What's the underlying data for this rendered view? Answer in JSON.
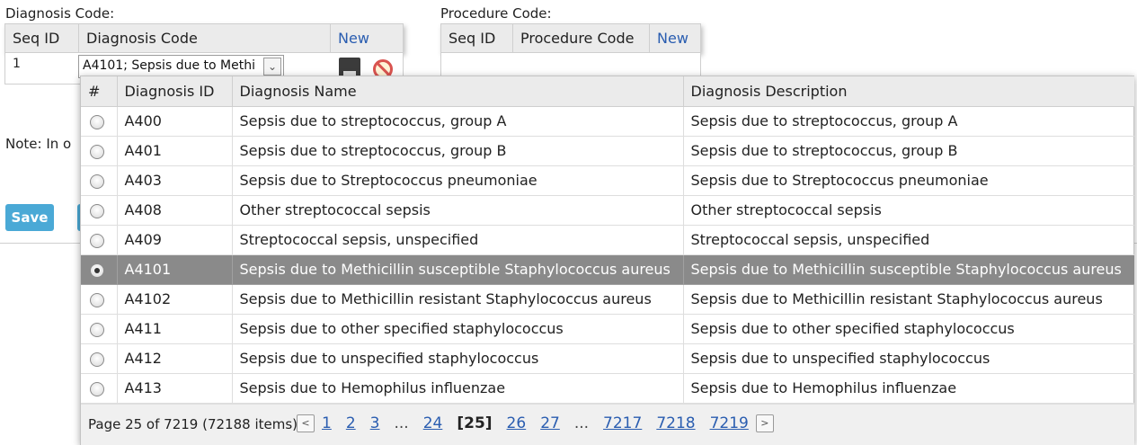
{
  "diagnosis": {
    "label": "Diagnosis Code:",
    "col_seq": "Seq ID",
    "col_code": "Diagnosis Code",
    "new_link": "New",
    "row_seq": "1",
    "combo_value": "A4101; Sepsis due to Methi",
    "combo_arrow": "⌄"
  },
  "procedure": {
    "label": "Procedure Code:",
    "col_seq": "Seq ID",
    "col_code": "Procedure Code",
    "new_link": "New"
  },
  "note": "Note: In o",
  "save_label": "Save",
  "dropdown": {
    "headers": [
      "#",
      "Diagnosis ID",
      "Diagnosis Name",
      "Diagnosis Description"
    ],
    "rows": [
      {
        "id": "A400",
        "name": "Sepsis due to streptococcus, group A",
        "desc": "Sepsis due to streptococcus, group A",
        "selected": false
      },
      {
        "id": "A401",
        "name": "Sepsis due to streptococcus, group B",
        "desc": "Sepsis due to streptococcus, group B",
        "selected": false
      },
      {
        "id": "A403",
        "name": "Sepsis due to Streptococcus pneumoniae",
        "desc": "Sepsis due to Streptococcus pneumoniae",
        "selected": false
      },
      {
        "id": "A408",
        "name": "Other streptococcal sepsis",
        "desc": "Other streptococcal sepsis",
        "selected": false
      },
      {
        "id": "A409",
        "name": "Streptococcal sepsis, unspecified",
        "desc": "Streptococcal sepsis, unspecified",
        "selected": false
      },
      {
        "id": "A4101",
        "name": "Sepsis due to Methicillin susceptible Staphylococcus aureus",
        "desc": "Sepsis due to Methicillin susceptible Staphylococcus aureus",
        "selected": true
      },
      {
        "id": "A4102",
        "name": "Sepsis due to Methicillin resistant Staphylococcus aureus",
        "desc": "Sepsis due to Methicillin resistant Staphylococcus aureus",
        "selected": false
      },
      {
        "id": "A411",
        "name": "Sepsis due to other specified staphylococcus",
        "desc": "Sepsis due to other specified staphylococcus",
        "selected": false
      },
      {
        "id": "A412",
        "name": "Sepsis due to unspecified staphylococcus",
        "desc": "Sepsis due to unspecified staphylococcus",
        "selected": false
      },
      {
        "id": "A413",
        "name": "Sepsis due to Hemophilus influenzae",
        "desc": "Sepsis due to Hemophilus influenzae",
        "selected": false
      }
    ],
    "pager": {
      "info": "Page 25 of 7219 (72188 items)",
      "prev": "<",
      "next": ">",
      "items": [
        {
          "t": "1",
          "k": "pg"
        },
        {
          "t": "2",
          "k": "pg"
        },
        {
          "t": "3",
          "k": "pg"
        },
        {
          "t": "...",
          "k": "dots"
        },
        {
          "t": "24",
          "k": "pg"
        },
        {
          "t": "[25]",
          "k": "cur"
        },
        {
          "t": "26",
          "k": "pg"
        },
        {
          "t": "27",
          "k": "pg"
        },
        {
          "t": "...",
          "k": "dots"
        },
        {
          "t": "7217",
          "k": "pg"
        },
        {
          "t": "7218",
          "k": "pg"
        },
        {
          "t": "7219",
          "k": "pg"
        }
      ]
    }
  }
}
